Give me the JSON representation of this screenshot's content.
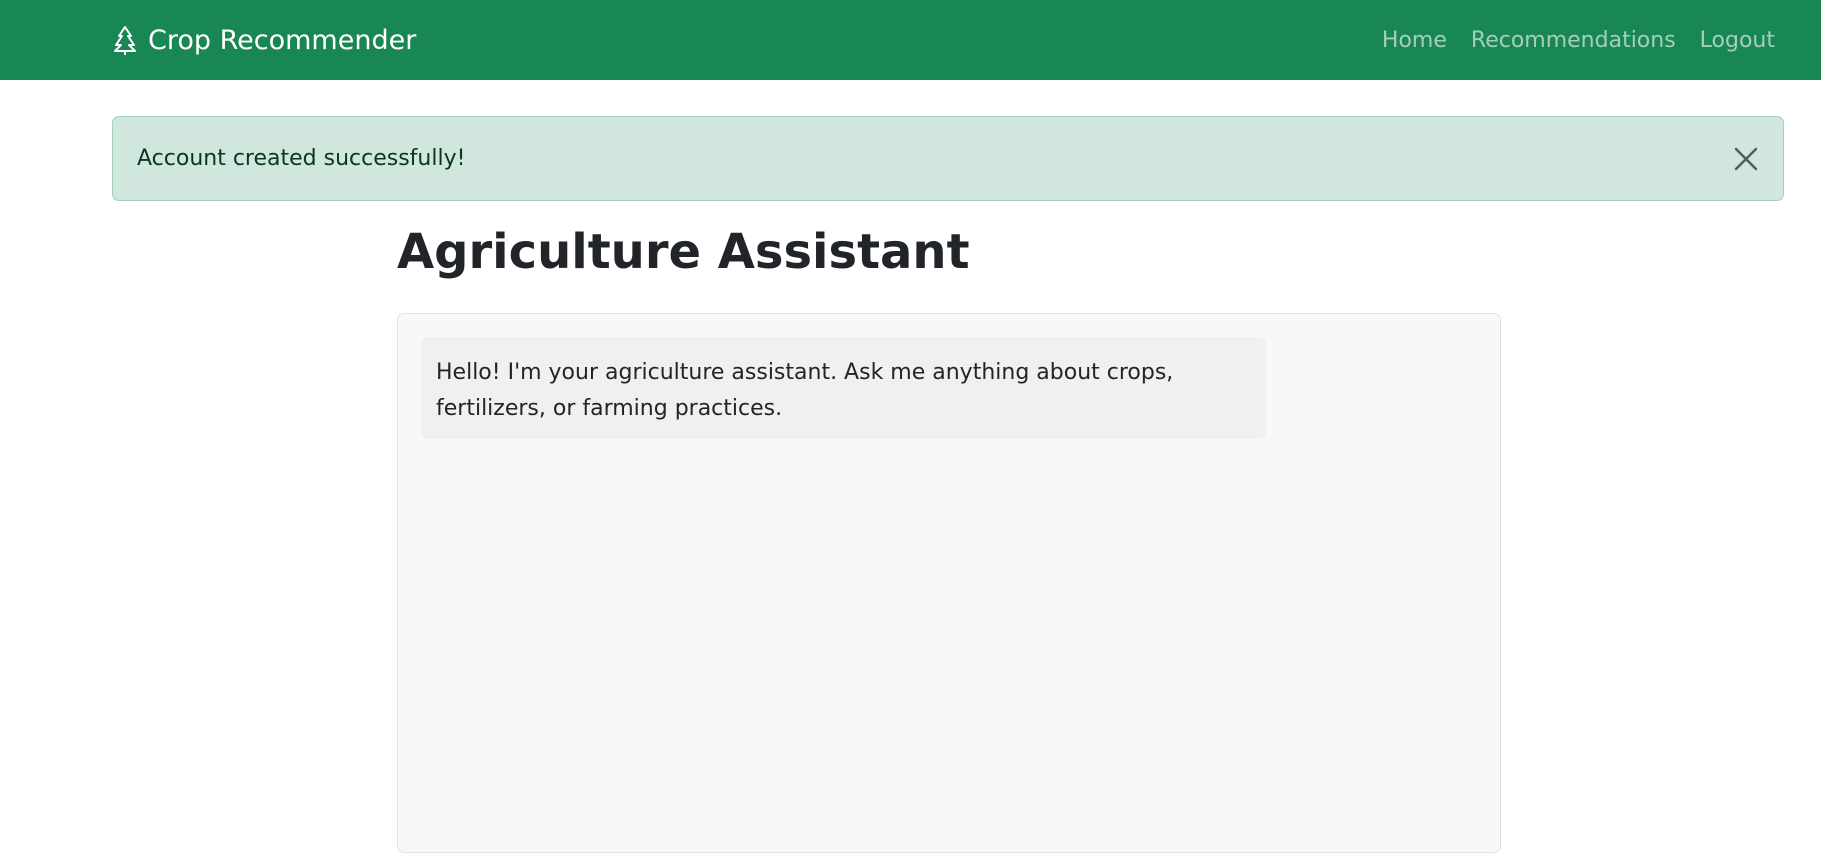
{
  "navbar": {
    "brand": "Crop Recommender",
    "brand_icon": "tree-icon",
    "links": [
      {
        "label": "Home"
      },
      {
        "label": "Recommendations"
      },
      {
        "label": "Logout"
      }
    ],
    "colors": {
      "background": "#198754",
      "link": "rgba(255,255,255,0.6)"
    }
  },
  "alert": {
    "message": "Account created successfully!",
    "close_icon": "close-icon",
    "colors": {
      "background": "#d1e7dd",
      "border": "#a3cfbb",
      "text": "#0a3622"
    }
  },
  "main": {
    "title": "Agriculture Assistant",
    "chat": {
      "messages": [
        {
          "role": "assistant",
          "text": "Hello! I'm your agriculture assistant. Ask me anything about crops, fertilizers, or farming practices."
        }
      ]
    }
  }
}
